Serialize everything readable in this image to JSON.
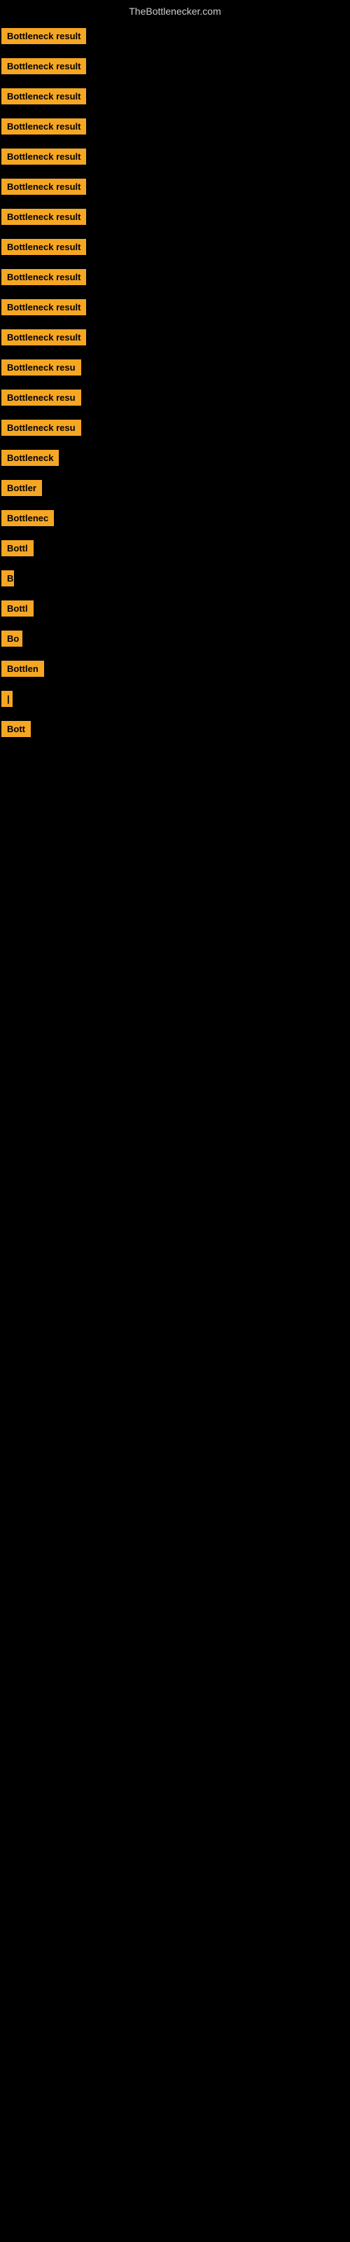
{
  "site": {
    "title": "TheBottlenecker.com"
  },
  "rows": [
    {
      "id": 0,
      "label": "Bottleneck result",
      "width": 155
    },
    {
      "id": 1,
      "label": "Bottleneck result",
      "width": 155
    },
    {
      "id": 2,
      "label": "Bottleneck result",
      "width": 155
    },
    {
      "id": 3,
      "label": "Bottleneck result",
      "width": 155
    },
    {
      "id": 4,
      "label": "Bottleneck result",
      "width": 155
    },
    {
      "id": 5,
      "label": "Bottleneck result",
      "width": 155
    },
    {
      "id": 6,
      "label": "Bottleneck result",
      "width": 155
    },
    {
      "id": 7,
      "label": "Bottleneck result",
      "width": 155
    },
    {
      "id": 8,
      "label": "Bottleneck result",
      "width": 155
    },
    {
      "id": 9,
      "label": "Bottleneck result",
      "width": 155
    },
    {
      "id": 10,
      "label": "Bottleneck result",
      "width": 145
    },
    {
      "id": 11,
      "label": "Bottleneck resu",
      "width": 130
    },
    {
      "id": 12,
      "label": "Bottleneck resu",
      "width": 125
    },
    {
      "id": 13,
      "label": "Bottleneck resu",
      "width": 118
    },
    {
      "id": 14,
      "label": "Bottleneck",
      "width": 95
    },
    {
      "id": 15,
      "label": "Bottler",
      "width": 65
    },
    {
      "id": 16,
      "label": "Bottlenec",
      "width": 85
    },
    {
      "id": 17,
      "label": "Bottl",
      "width": 50
    },
    {
      "id": 18,
      "label": "B",
      "width": 18
    },
    {
      "id": 19,
      "label": "Bottl",
      "width": 50
    },
    {
      "id": 20,
      "label": "Bo",
      "width": 30
    },
    {
      "id": 21,
      "label": "Bottlen",
      "width": 72
    },
    {
      "id": 22,
      "label": "|",
      "width": 10
    },
    {
      "id": 23,
      "label": "Bott",
      "width": 45
    }
  ]
}
